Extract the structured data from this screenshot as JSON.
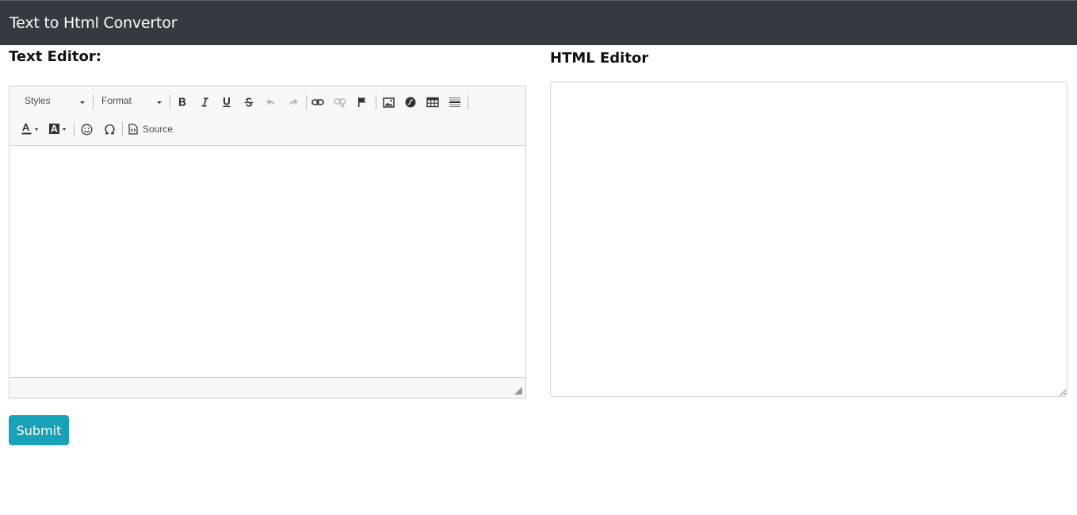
{
  "navbar": {
    "title": "Text to Html Convertor"
  },
  "left": {
    "heading": "Text Editor:"
  },
  "right": {
    "heading": "HTML Editor",
    "value": ""
  },
  "toolbar": {
    "styles_label": "Styles",
    "format_label": "Format",
    "source_label": "Source",
    "row1_icons": [
      "bold-icon",
      "italic-icon",
      "underline-icon",
      "strikethrough-icon",
      "undo-icon",
      "redo-icon",
      "link-icon",
      "unlink-icon",
      "anchor-icon",
      "image-icon",
      "flash-icon",
      "table-icon",
      "horizontal-rule-icon"
    ],
    "row2_icons": [
      "text-color-icon",
      "background-color-icon",
      "smiley-icon",
      "special-char-icon",
      "source-icon"
    ]
  },
  "submit": {
    "label": "Submit"
  },
  "colors": {
    "navbar_bg": "#343a40",
    "submit_bg": "#17a2b8",
    "toolbar_bg": "#f8f8f8"
  }
}
